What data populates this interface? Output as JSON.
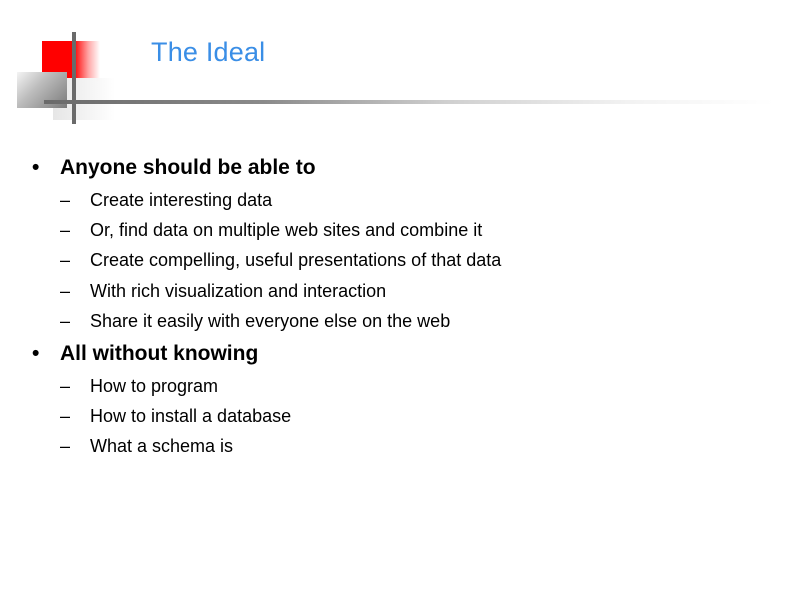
{
  "slide": {
    "title": "The Ideal",
    "sections": [
      {
        "heading": "Anyone should be able to",
        "items": [
          "Create interesting data",
          "Or, find data on multiple web sites and combine it",
          "Create compelling, useful presentations of that data",
          "With rich visualization and interaction",
          "Share it easily with everyone else on the web"
        ]
      },
      {
        "heading": "All without knowing",
        "items": [
          "How to program",
          "How to install a database",
          "What a schema is"
        ]
      }
    ],
    "bullet_glyph": "•",
    "dash_glyph": "–",
    "colors": {
      "title": "#3a8ee6",
      "logo_red": "#ff0000",
      "rule_gray": "#6a6a6a"
    }
  }
}
